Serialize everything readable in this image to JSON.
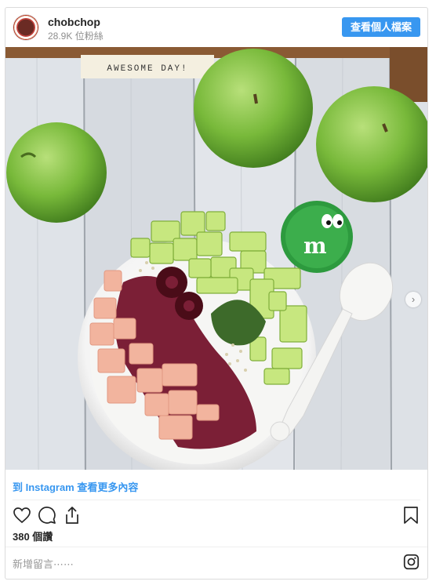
{
  "header": {
    "username": "chobchop",
    "followers": "28.9K 位粉絲",
    "profile_button": "查看個人檔案"
  },
  "photo": {
    "sign_text": "AWESOME DAY!",
    "carousel_total": 2,
    "carousel_active": 1
  },
  "footer": {
    "view_more": "到 Instagram 查看更多內容",
    "likes": "380 個讚",
    "comment_placeholder": "新增留言⋯⋯"
  },
  "colors": {
    "accent": "#3897f0",
    "text": "#262626",
    "muted": "#8e8e8e"
  },
  "icons": [
    "heart-icon",
    "comment-icon",
    "share-icon",
    "bookmark-icon",
    "instagram-icon",
    "chevron-right-icon"
  ]
}
